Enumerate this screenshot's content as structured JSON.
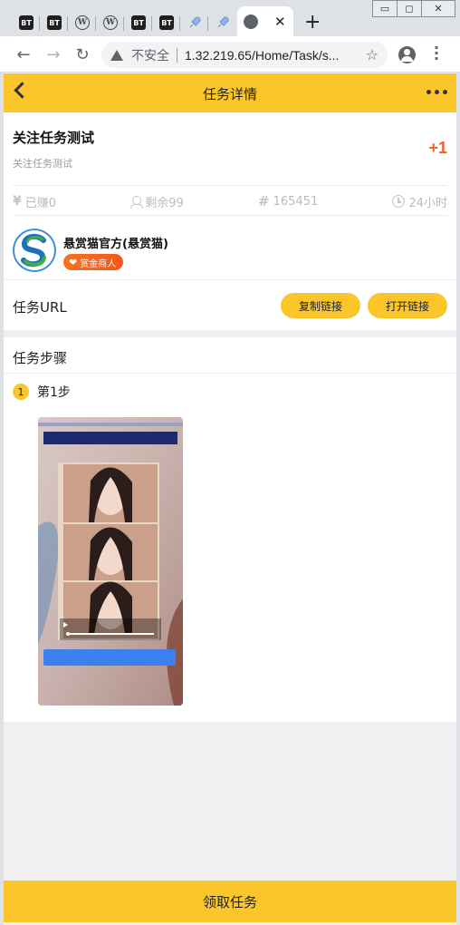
{
  "browser": {
    "tabs": [
      {
        "icon": "bt-icon",
        "label": "BT"
      },
      {
        "icon": "bt-icon",
        "label": "BT"
      },
      {
        "icon": "wordpress-icon",
        "label": "W"
      },
      {
        "icon": "wordpress-icon",
        "label": "W"
      },
      {
        "icon": "bt-icon",
        "label": "BT"
      },
      {
        "icon": "bt-icon",
        "label": "BT"
      },
      {
        "icon": "rocket-icon",
        "label": "🚀"
      },
      {
        "icon": "rocket-icon",
        "label": "🚀"
      }
    ],
    "active_tab_close": "✕",
    "new_tab": "+",
    "window_controls": {
      "minimize": "▭",
      "maximize": "◻",
      "close": "✕"
    },
    "security_text": "不安全",
    "url": "1.32.219.65/Home/Task/s..."
  },
  "app": {
    "title": "任务详情",
    "task": {
      "title": "关注任务测试",
      "subtitle": "关注任务测试",
      "reward": "+1",
      "stats": {
        "earned": "已赚0",
        "remaining": "剩余99",
        "id": "165451",
        "duration": "24小时"
      },
      "owner": {
        "name": "悬赏猫官方(悬赏猫)",
        "badge": "赏金商人"
      }
    },
    "url_section": {
      "label": "任务URL",
      "copy_button": "复制链接",
      "open_button": "打开链接"
    },
    "steps_section": {
      "title": "任务步骤",
      "steps": [
        {
          "number": "1",
          "label": "第1步"
        }
      ]
    },
    "claim_button": "领取任务"
  },
  "colors": {
    "accent": "#fac62c",
    "reward": "#f0612e",
    "badge": "#f3561f"
  }
}
